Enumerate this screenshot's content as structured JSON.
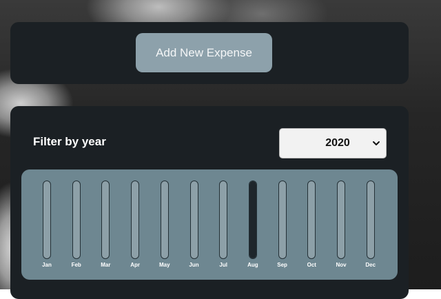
{
  "new_expense": {
    "button_label": "Add New Expense"
  },
  "filter": {
    "label": "Filter by year",
    "selected_year": "2020"
  },
  "chart_data": {
    "type": "bar",
    "categories": [
      "Jan",
      "Feb",
      "Mar",
      "Apr",
      "May",
      "Jun",
      "Jul",
      "Aug",
      "Sep",
      "Oct",
      "Nov",
      "Dec"
    ],
    "values": [
      0,
      0,
      0,
      0,
      0,
      0,
      0,
      1,
      0,
      0,
      0,
      0
    ],
    "ylim": [
      0,
      1
    ]
  },
  "colors": {
    "card_background": "#1b2024",
    "button_background": "#8da1ab",
    "chart_background": "#6e8791",
    "bar_empty": "#8da0a8",
    "bar_fill": "#1e262b"
  },
  "icons": {
    "select_caret": "chevron-down-icon"
  }
}
